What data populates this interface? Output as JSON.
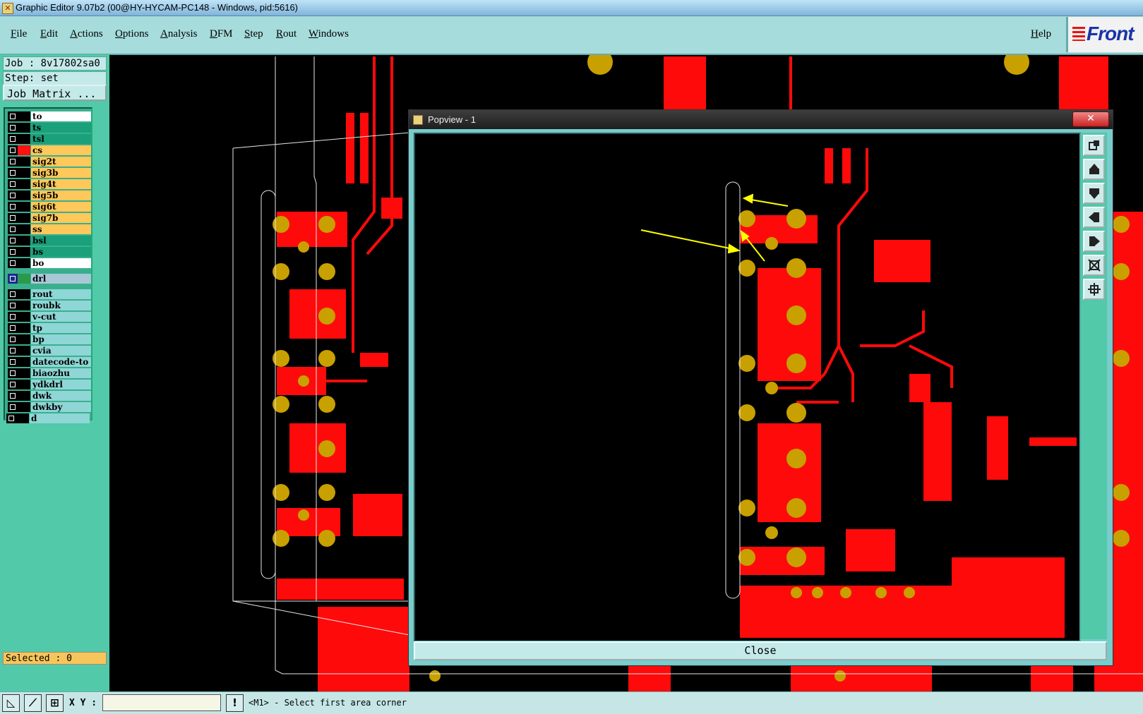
{
  "window": {
    "title": "Graphic Editor 9.07b2 (00@HY-HYCAM-PC148 - Windows, pid:5616)"
  },
  "menu": {
    "items": [
      "File",
      "Edit",
      "Actions",
      "Options",
      "Analysis",
      "DFM",
      "Step",
      "Rout",
      "Windows"
    ],
    "help": "Help",
    "brand": "Front"
  },
  "left_panel": {
    "job": "Job : 8v17802sa0",
    "step": "Step: set",
    "job_matrix": "Job Matrix ...",
    "layers": [
      {
        "name": "to",
        "color": "#ffffff"
      },
      {
        "name": "ts",
        "color": "#1aa07a"
      },
      {
        "name": "tsl",
        "color": "#1aa07a"
      },
      {
        "name": "cs",
        "color": "#ffc85a"
      },
      {
        "name": "sig2t",
        "color": "#ffc85a"
      },
      {
        "name": "sig3b",
        "color": "#ffc85a"
      },
      {
        "name": "sig4t",
        "color": "#ffc85a"
      },
      {
        "name": "sig5b",
        "color": "#ffc85a"
      },
      {
        "name": "sig6t",
        "color": "#ffc85a"
      },
      {
        "name": "sig7b",
        "color": "#ffc85a"
      },
      {
        "name": "ss",
        "color": "#ffc85a"
      },
      {
        "name": "bsl",
        "color": "#1aa07a"
      },
      {
        "name": "bs",
        "color": "#1aa07a"
      },
      {
        "name": "bo",
        "color": "#ffffff"
      }
    ],
    "drill_layer": {
      "name": "drl",
      "color": "#a8c8d8"
    },
    "other_layers": [
      "rout",
      "roubk",
      "v-cut",
      "tp",
      "bp",
      "cvia",
      "datecode-to",
      "biaozhu",
      "ydkdrl",
      "dwk",
      "dwkby",
      "d"
    ],
    "selected": "Selected : 0"
  },
  "popup": {
    "title": "Popview - 1",
    "close_label": "Close",
    "tool_icons": [
      "zoom-home-icon",
      "pan-up-icon",
      "pan-down-icon",
      "pan-left-icon",
      "pan-right-icon",
      "zoom-fit-icon",
      "zoom-center-icon"
    ]
  },
  "status": {
    "xy_label": "X Y :",
    "xy_value": "",
    "message": "<M1> - Select first area corner",
    "info_button": "!"
  },
  "colors": {
    "copper": "#ff0a0a",
    "pad": "#c8a000",
    "board": "#000000",
    "panel": "#52c9a8",
    "annotation": "#ffff00"
  }
}
